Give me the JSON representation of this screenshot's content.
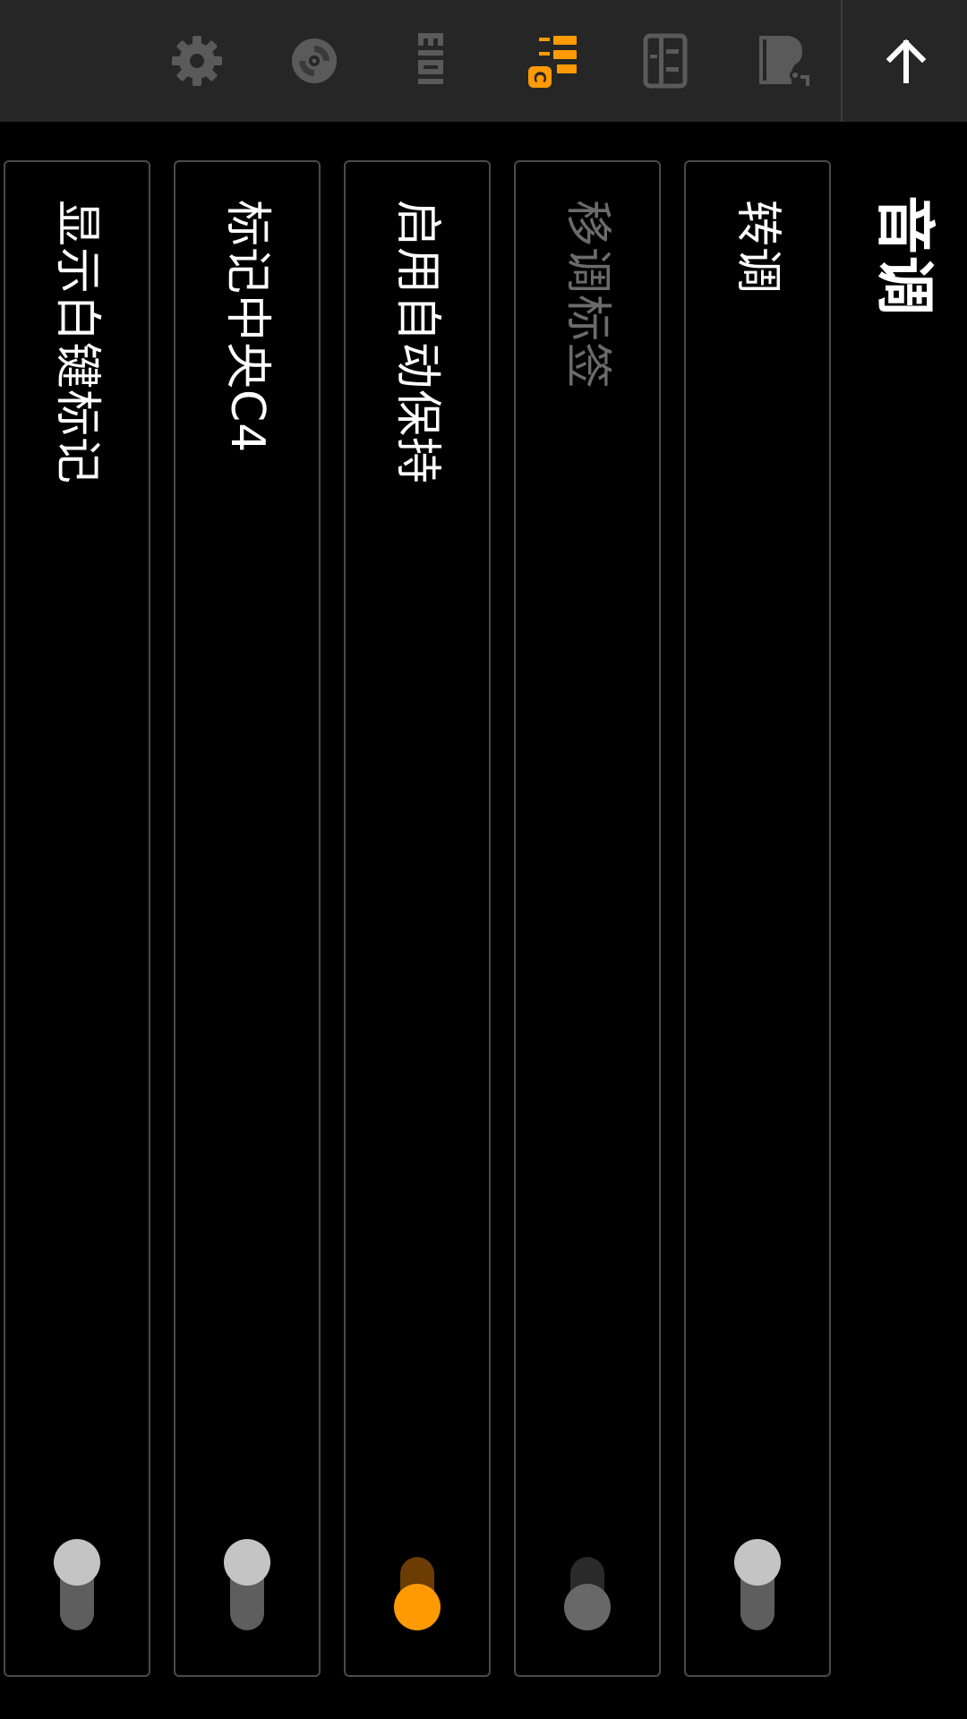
{
  "toolbar": {
    "icons": {
      "settings": "gear-icon",
      "recordings": "disc-icon",
      "midi": "midi-icon",
      "keyboard": "piano-keys-c-icon",
      "songbook": "songbook-icon",
      "instrument": "grand-piano-icon",
      "back": "arrow-up-icon"
    },
    "midi_label": "midi",
    "keys_badge": "C",
    "colors": {
      "active": "#ff9a05",
      "inactive": "#5a5a5a",
      "back_arrow": "#ffffff"
    }
  },
  "section": {
    "title": "音调"
  },
  "settings": [
    {
      "label": "转调",
      "enabled": false,
      "disabled": false
    },
    {
      "label": "移调标签",
      "enabled": false,
      "disabled": true
    },
    {
      "label": "启用自动保持",
      "enabled": true,
      "disabled": false
    },
    {
      "label": "标记中央C4",
      "enabled": false,
      "disabled": false
    },
    {
      "label": "显示白键标记",
      "enabled": false,
      "disabled": false
    }
  ],
  "colors": {
    "accent": "#ff9a05",
    "background": "#000000",
    "toolbar": "#262626"
  }
}
